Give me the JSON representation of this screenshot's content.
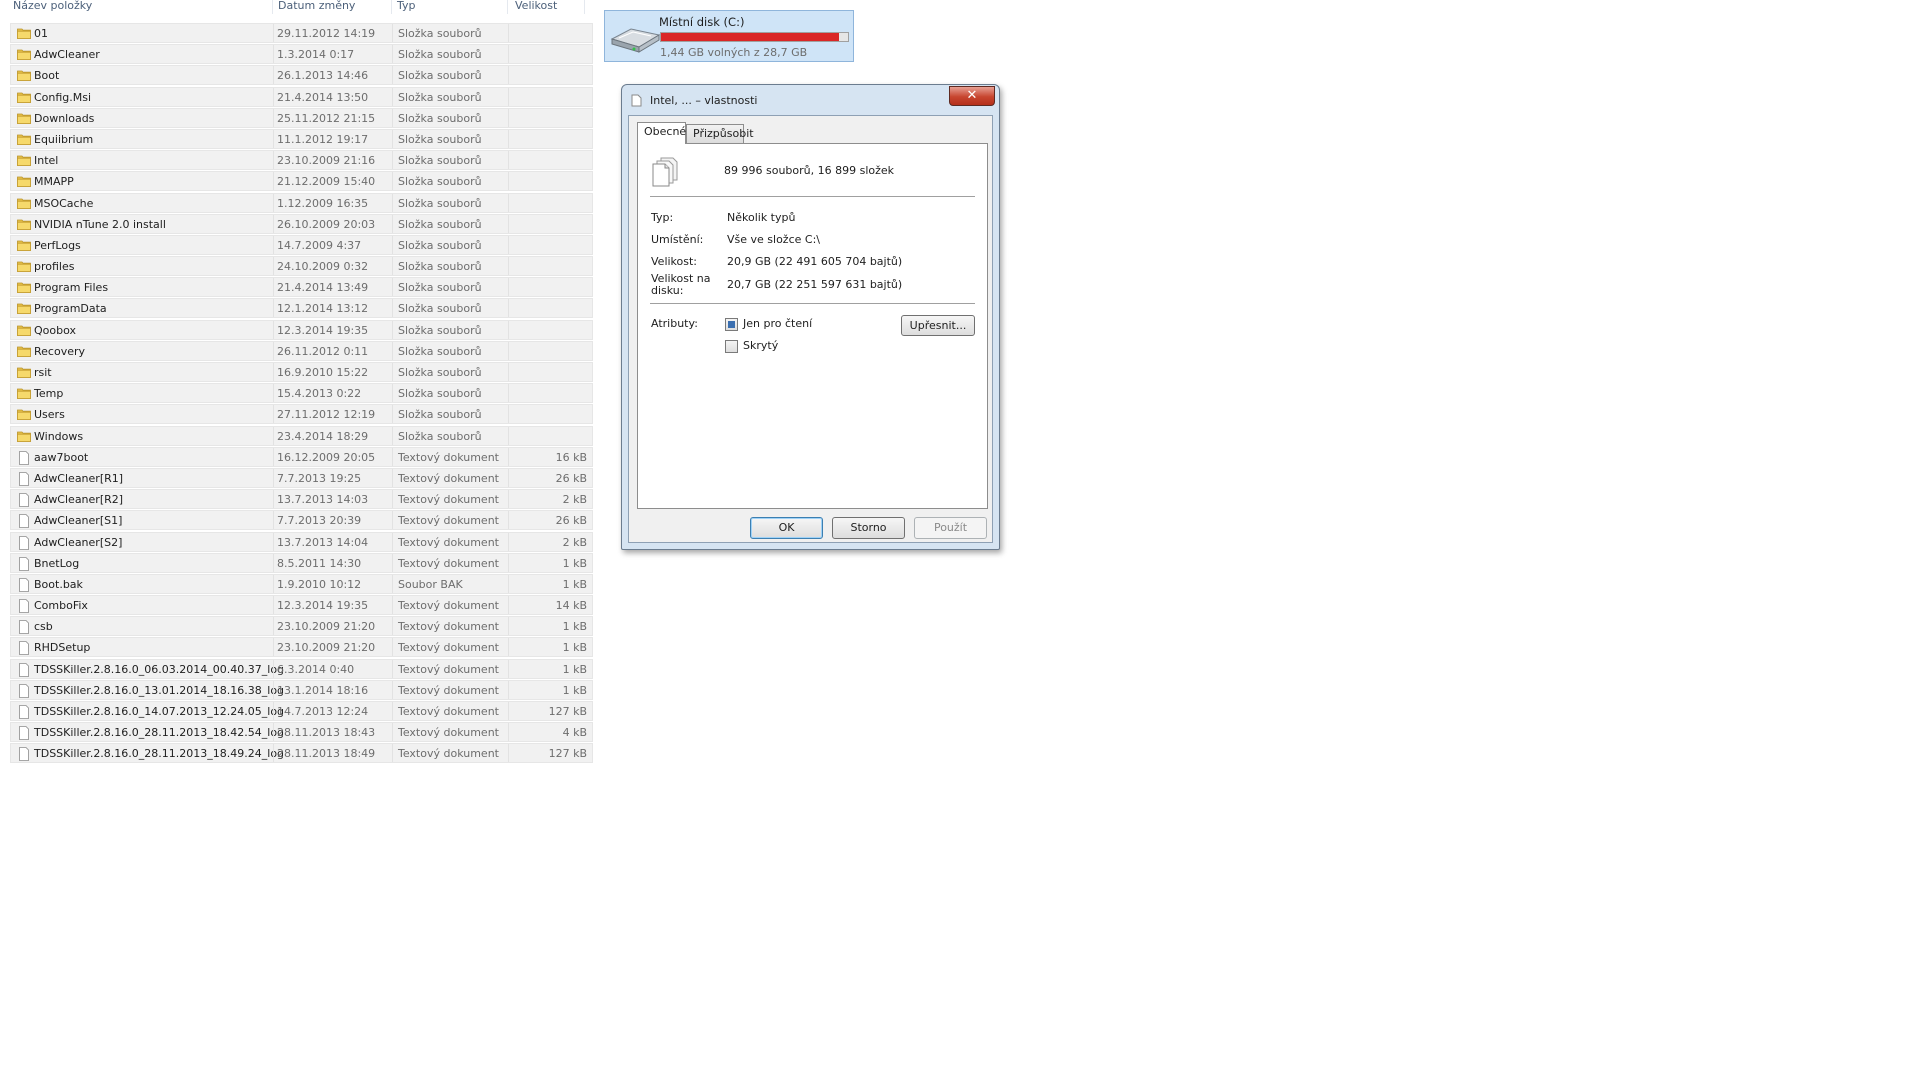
{
  "columns": {
    "name": "Název položky",
    "date": "Datum změny",
    "type": "Typ",
    "size": "Velikost"
  },
  "files": [
    {
      "name": "01",
      "date": "29.11.2012 14:19",
      "type": "Složka souborů",
      "size": "",
      "kind": "folder"
    },
    {
      "name": "AdwCleaner",
      "date": "1.3.2014 0:17",
      "type": "Složka souborů",
      "size": "",
      "kind": "folder"
    },
    {
      "name": "Boot",
      "date": "26.1.2013 14:46",
      "type": "Složka souborů",
      "size": "",
      "kind": "folder"
    },
    {
      "name": "Config.Msi",
      "date": "21.4.2014 13:50",
      "type": "Složka souborů",
      "size": "",
      "kind": "folder"
    },
    {
      "name": "Downloads",
      "date": "25.11.2012 21:15",
      "type": "Složka souborů",
      "size": "",
      "kind": "folder"
    },
    {
      "name": "Equiibrium",
      "date": "11.1.2012 19:17",
      "type": "Složka souborů",
      "size": "",
      "kind": "folder"
    },
    {
      "name": "Intel",
      "date": "23.10.2009 21:16",
      "type": "Složka souborů",
      "size": "",
      "kind": "folder"
    },
    {
      "name": "MMAPP",
      "date": "21.12.2009 15:40",
      "type": "Složka souborů",
      "size": "",
      "kind": "folder"
    },
    {
      "name": "MSOCache",
      "date": "1.12.2009 16:35",
      "type": "Složka souborů",
      "size": "",
      "kind": "folder"
    },
    {
      "name": "NVIDIA nTune 2.0 install",
      "date": "26.10.2009 20:03",
      "type": "Složka souborů",
      "size": "",
      "kind": "folder"
    },
    {
      "name": "PerfLogs",
      "date": "14.7.2009 4:37",
      "type": "Složka souborů",
      "size": "",
      "kind": "folder"
    },
    {
      "name": "profiles",
      "date": "24.10.2009 0:32",
      "type": "Složka souborů",
      "size": "",
      "kind": "folder"
    },
    {
      "name": "Program Files",
      "date": "21.4.2014 13:49",
      "type": "Složka souborů",
      "size": "",
      "kind": "folder"
    },
    {
      "name": "ProgramData",
      "date": "12.1.2014 13:12",
      "type": "Složka souborů",
      "size": "",
      "kind": "folder"
    },
    {
      "name": "Qoobox",
      "date": "12.3.2014 19:35",
      "type": "Složka souborů",
      "size": "",
      "kind": "folder"
    },
    {
      "name": "Recovery",
      "date": "26.11.2012 0:11",
      "type": "Složka souborů",
      "size": "",
      "kind": "folder"
    },
    {
      "name": "rsit",
      "date": "16.9.2010 15:22",
      "type": "Složka souborů",
      "size": "",
      "kind": "folder"
    },
    {
      "name": "Temp",
      "date": "15.4.2013 0:22",
      "type": "Složka souborů",
      "size": "",
      "kind": "folder"
    },
    {
      "name": "Users",
      "date": "27.11.2012 12:19",
      "type": "Složka souborů",
      "size": "",
      "kind": "folder"
    },
    {
      "name": "Windows",
      "date": "23.4.2014 18:29",
      "type": "Složka souborů",
      "size": "",
      "kind": "folder"
    },
    {
      "name": "aaw7boot",
      "date": "16.12.2009 20:05",
      "type": "Textový dokument",
      "size": "16 kB",
      "kind": "file"
    },
    {
      "name": "AdwCleaner[R1]",
      "date": "7.7.2013 19:25",
      "type": "Textový dokument",
      "size": "26 kB",
      "kind": "file"
    },
    {
      "name": "AdwCleaner[R2]",
      "date": "13.7.2013 14:03",
      "type": "Textový dokument",
      "size": "2 kB",
      "kind": "file"
    },
    {
      "name": "AdwCleaner[S1]",
      "date": "7.7.2013 20:39",
      "type": "Textový dokument",
      "size": "26 kB",
      "kind": "file"
    },
    {
      "name": "AdwCleaner[S2]",
      "date": "13.7.2013 14:04",
      "type": "Textový dokument",
      "size": "2 kB",
      "kind": "file"
    },
    {
      "name": "BnetLog",
      "date": "8.5.2011 14:30",
      "type": "Textový dokument",
      "size": "1 kB",
      "kind": "file"
    },
    {
      "name": "Boot.bak",
      "date": "1.9.2010 10:12",
      "type": "Soubor BAK",
      "size": "1 kB",
      "kind": "file"
    },
    {
      "name": "ComboFix",
      "date": "12.3.2014 19:35",
      "type": "Textový dokument",
      "size": "14 kB",
      "kind": "file"
    },
    {
      "name": "csb",
      "date": "23.10.2009 21:20",
      "type": "Textový dokument",
      "size": "1 kB",
      "kind": "file"
    },
    {
      "name": "RHDSetup",
      "date": "23.10.2009 21:20",
      "type": "Textový dokument",
      "size": "1 kB",
      "kind": "file"
    },
    {
      "name": "TDSSKiller.2.8.16.0_06.03.2014_00.40.37_log",
      "date": "6.3.2014 0:40",
      "type": "Textový dokument",
      "size": "1 kB",
      "kind": "file"
    },
    {
      "name": "TDSSKiller.2.8.16.0_13.01.2014_18.16.38_log",
      "date": "13.1.2014 18:16",
      "type": "Textový dokument",
      "size": "1 kB",
      "kind": "file"
    },
    {
      "name": "TDSSKiller.2.8.16.0_14.07.2013_12.24.05_log",
      "date": "14.7.2013 12:24",
      "type": "Textový dokument",
      "size": "127 kB",
      "kind": "file"
    },
    {
      "name": "TDSSKiller.2.8.16.0_28.11.2013_18.42.54_log",
      "date": "28.11.2013 18:43",
      "type": "Textový dokument",
      "size": "4 kB",
      "kind": "file"
    },
    {
      "name": "TDSSKiller.2.8.16.0_28.11.2013_18.49.24_log",
      "date": "28.11.2013 18:49",
      "type": "Textový dokument",
      "size": "127 kB",
      "kind": "file"
    }
  ],
  "drive": {
    "title": "Místní disk (C:)",
    "free_text": "1,44 GB volných z 28,7 GB",
    "used_fraction": 0.95,
    "bar_color": "#da2626",
    "icon": "hard-drive-icon"
  },
  "dialog": {
    "title": "Intel, ... – vlastnosti",
    "close_label": "✕",
    "tabs": [
      "Obecné",
      "Přizpůsobit"
    ],
    "active_tab": "Obecné",
    "summary": "89 996 souborů, 16 899 složek",
    "props": {
      "type_label": "Typ:",
      "type_value": "Několik typů",
      "location_label": "Umístění:",
      "location_value": "Vše ve složce C:\\",
      "size_label": "Velikost:",
      "size_value": "20,9 GB (22 491 605 704 bajtů)",
      "disk_size_label_1": "Velikost na",
      "disk_size_label_2": "disku:",
      "disk_size_value": "20,7 GB (22 251 597 631 bajtů)",
      "attributes_label": "Atributy:",
      "readonly_label": "Jen pro čtení",
      "readonly_state": "mixed",
      "hidden_label": "Skrytý",
      "hidden_state": "unchecked",
      "advanced_button": "Upřesnit..."
    },
    "buttons": {
      "ok": "OK",
      "cancel": "Storno",
      "apply": "Použít"
    }
  }
}
